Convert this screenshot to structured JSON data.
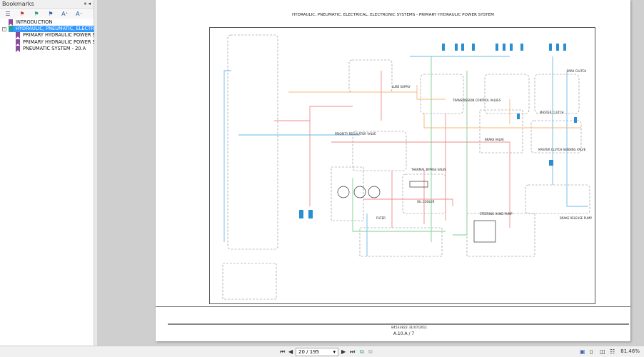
{
  "bookmarks": {
    "title": "Bookmarks",
    "items": [
      {
        "label": "INTRODUCTION",
        "level": 0,
        "selected": false
      },
      {
        "label": "HYDRAULIC, PNEUMATIC, ELECTRICAL, ELECTRONIC SYSTEMS",
        "level": 0,
        "selected": true
      },
      {
        "label": "PRIMARY HYDRAULIC POWER SYSTEM",
        "level": 1,
        "selected": false
      },
      {
        "label": "PRIMARY HYDRAULIC POWER SYSTEM",
        "level": 1,
        "selected": false
      },
      {
        "label": "PNEUMATIC SYSTEM - 20.A",
        "level": 1,
        "selected": false
      }
    ]
  },
  "page": {
    "title": "HYDRAULIC, PNEUMATIC, ELECTRICAL, ELECTRONIC SYSTEMS - PRIMARY HYDRAULIC POWER SYSTEM",
    "labels": {
      "thermal": "THERMAL BYPASS VALVE",
      "cooler": "OIL COOLER",
      "filter": "FILTER",
      "priority": "PRIORITY REGULATOR VALVE",
      "steering": "STEERING HAND PUMP",
      "master": "MASTER CLUTCH",
      "sensing": "MASTER CLUTCH SENSING VALVE",
      "brake": "BRAKE VALVE",
      "park": "PARK CLUTCH",
      "trans": "TRANSMISSION CONTROL VALVES",
      "release": "BRAKE RELEASE PUMP",
      "lube": "LUBE SUPPLY"
    },
    "footer_doc": "84533822 31/07/2011",
    "footer_page": "A.10.A / 7"
  },
  "toolbar": {
    "page_value": "20 / 195",
    "zoom": "81.46%"
  },
  "colors": {
    "pressure": "#f08a8a",
    "return": "#6ab8e8",
    "lube": "#7ccf8f",
    "pilot": "#f5b87a",
    "selection": "#3399ff"
  }
}
